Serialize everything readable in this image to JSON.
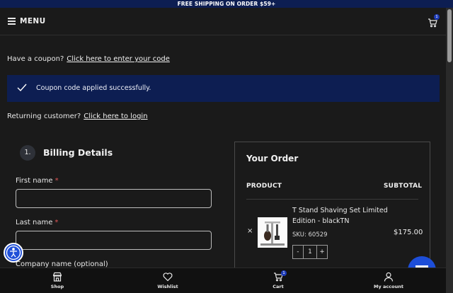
{
  "topbar": {
    "text": "FREE SHIPPING ON ORDER $59+"
  },
  "header": {
    "menu_label": "MENU",
    "cart_count": "1"
  },
  "coupon": {
    "prompt": "Have a coupon?",
    "link": "Click here to enter your code"
  },
  "notice": {
    "message": "Coupon code applied successfully."
  },
  "login": {
    "prompt": "Returning customer?",
    "link": "Click here to login"
  },
  "billing": {
    "step": "1.",
    "title": "Billing Details",
    "fields": [
      {
        "label": "First name",
        "required": "*"
      },
      {
        "label": "Last name",
        "required": "*"
      },
      {
        "label": "Company name (optional)"
      }
    ]
  },
  "order": {
    "title": "Your Order",
    "col_product": "PRODUCT",
    "col_subtotal": "SUBTOTAL",
    "item": {
      "remove": "×",
      "name": "T Stand Shaving Set Limited Edition - blackTN",
      "sku": "SKU: 60529",
      "price": "$175.00",
      "qty_minus": "-",
      "qty": "1",
      "qty_plus": "+"
    }
  },
  "bottom_nav": {
    "shop": "Shop",
    "wishlist": "Wishlist",
    "cart": "Cart",
    "cart_count": "1",
    "account": "My account"
  },
  "colors": {
    "brand_navy": "#0d1e52",
    "accent_blue": "#1d4ed8",
    "required_red": "#e05555"
  }
}
